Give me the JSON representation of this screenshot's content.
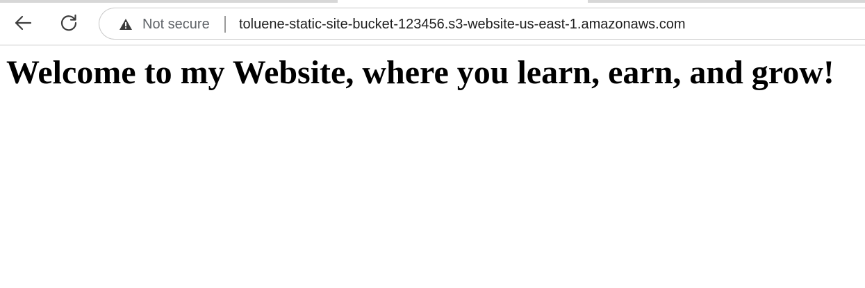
{
  "browser": {
    "back_icon": "back-arrow-icon",
    "reload_icon": "reload-icon",
    "address_bar": {
      "security_icon": "warning-triangle-icon",
      "security_label": "Not secure",
      "url": "toluene-static-site-bucket-123456.s3-website-us-east-1.amazonaws.com"
    }
  },
  "page": {
    "heading": "Welcome to my Website, where you learn, earn, and grow!"
  }
}
